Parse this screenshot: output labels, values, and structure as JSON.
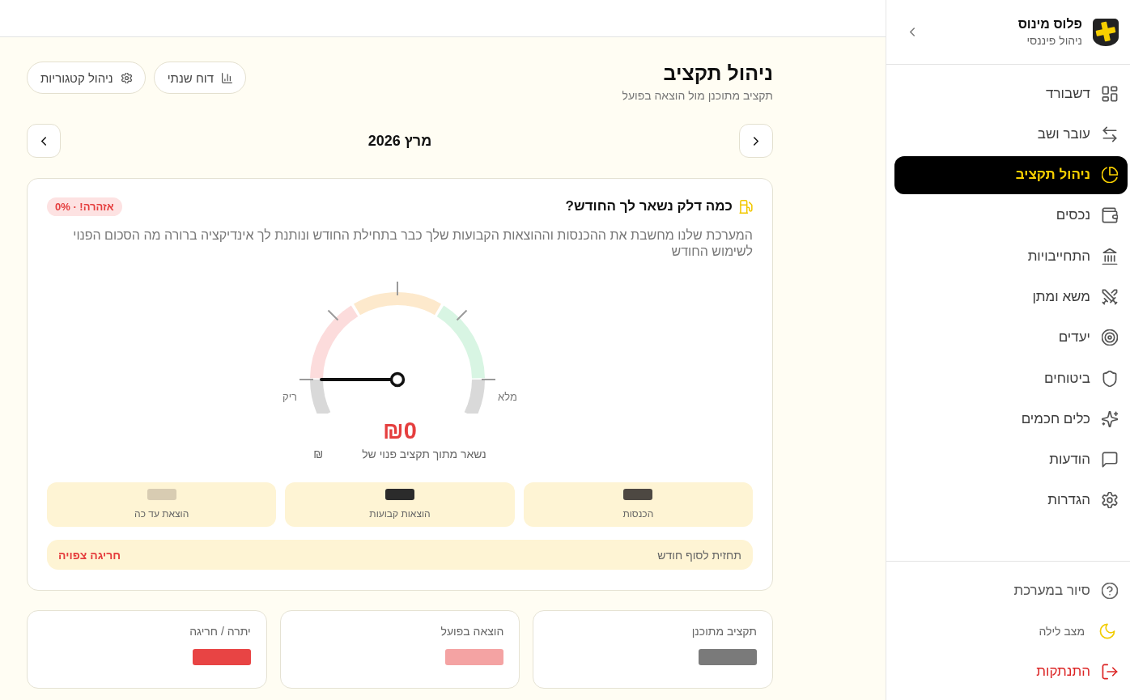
{
  "sidebar": {
    "brand": {
      "name": "פלוס מינוס",
      "tagline": "ניהול פיננסי"
    },
    "nav_items": [
      {
        "label": "דשבורד",
        "selected": false
      },
      {
        "label": "עובר ושב",
        "selected": false
      },
      {
        "label": "ניהול תקציב",
        "selected": true
      },
      {
        "label": "נכסים",
        "selected": false
      },
      {
        "label": "התחייבויות",
        "selected": false
      },
      {
        "label": "משא ומתן",
        "selected": false
      },
      {
        "label": "יעדים",
        "selected": false
      },
      {
        "label": "ביטוחים",
        "selected": false
      },
      {
        "label": "כלים חכמים",
        "selected": false
      },
      {
        "label": "הודעות",
        "selected": false
      },
      {
        "label": "הגדרות",
        "selected": false
      }
    ],
    "footer_items": [
      {
        "label": "סיור במערכת",
        "kind": "link"
      },
      {
        "label": "מצב לילה",
        "kind": "toggle"
      },
      {
        "label": "התנתקות",
        "kind": "danger"
      }
    ]
  },
  "header": {
    "title": "ניהול תקציב",
    "subtitle": "תקציב מתוכנן מול הוצאה בפועל",
    "actions": [
      {
        "label": "דוח שנתי"
      },
      {
        "label": "ניהול קטגוריות"
      }
    ]
  },
  "month_nav": {
    "label": "מרץ 2026"
  },
  "fuel_card": {
    "title": "כמה דלק נשאר לך החודש?",
    "badge": "אזהרה! · 0%",
    "description": "המערכת שלנו מחשבת את ההכנסות וההוצאות הקבועות שלך כבר בתחילת החודש ונותנת לך אינדיקציה ברורה מה הסכום הפנוי לשימוש החודש",
    "gauge": {
      "level": 0,
      "empty_label": "ריק",
      "full_label": "מלא"
    },
    "remaining_amount": "₪0",
    "remaining_caption": "נשאר מתוך תקציב פנוי של",
    "currency": "₪",
    "stats": [
      {
        "label": "הכנסות",
        "color": "#4d4842"
      },
      {
        "label": "הוצאות קבועות",
        "color": "#2b2b2b"
      },
      {
        "label": "הוצאת עד כה",
        "color": "#d8ccb2"
      }
    ],
    "forecast": {
      "label": "תחזית לסוף חודש",
      "value": "חריגה צפויה"
    }
  },
  "summary_cards": [
    {
      "label": "תקציב מתוכנן",
      "color": "#7a7a7a"
    },
    {
      "label": "הוצאה בפועל",
      "color": "#f4a3a3"
    },
    {
      "label": "יתרה / חריגה",
      "color": "#e84444"
    }
  ]
}
